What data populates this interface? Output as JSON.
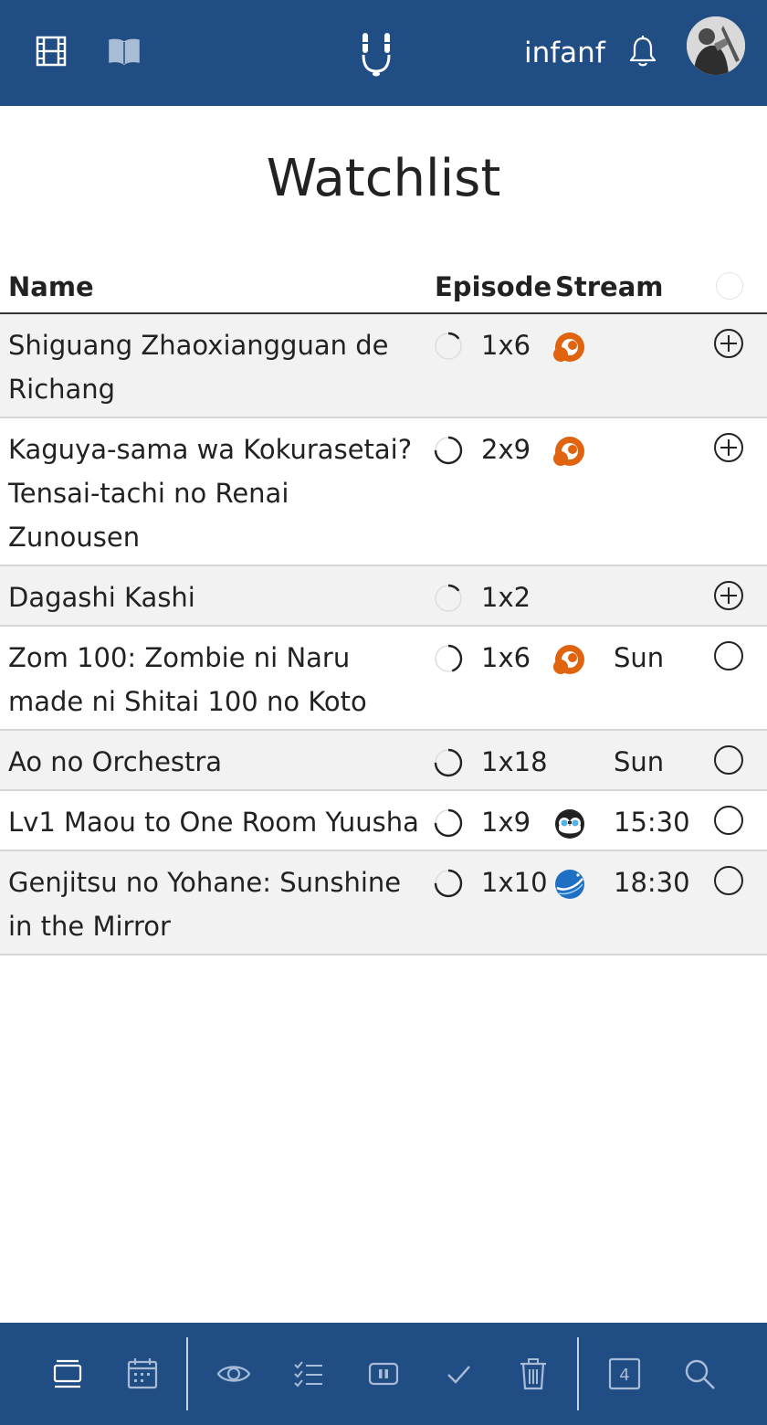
{
  "header": {
    "username": "infanf",
    "icons": [
      "film-icon",
      "book-icon",
      "logo-icon",
      "bell-icon",
      "avatar"
    ]
  },
  "page": {
    "title": "Watchlist"
  },
  "table": {
    "columns": {
      "name": "Name",
      "episode": "Episode",
      "stream": "Stream"
    },
    "rows": [
      {
        "name": "Shiguang Zhaoxiangguan de Richang",
        "episode": "1x6",
        "stream": "crunchyroll-icon",
        "airs": "",
        "action": "add-icon",
        "progress": 0.15
      },
      {
        "name": "Kaguya-sama wa Kokurasetai? Tensai-tachi no Renai Zunousen",
        "episode": "2x9",
        "stream": "crunchyroll-icon",
        "airs": "",
        "action": "add-icon",
        "progress": 0.75
      },
      {
        "name": "Dagashi Kashi",
        "episode": "1x2",
        "stream": "",
        "airs": "",
        "action": "add-icon",
        "progress": 0.15
      },
      {
        "name": "Zom 100: Zombie ni Naru made ni Shitai 100 no Koto",
        "episode": "1x6",
        "stream": "crunchyroll-icon",
        "airs": "Sun",
        "action": "circle-icon",
        "progress": 0.45
      },
      {
        "name": "Ao no Orchestra",
        "episode": "1x18",
        "stream": "",
        "airs": "Sun",
        "action": "circle-icon",
        "progress": 0.75
      },
      {
        "name": "Lv1 Maou to One Room Yuusha",
        "episode": "1x9",
        "stream": "hidive-icon",
        "airs": "15:30",
        "action": "circle-icon",
        "progress": 0.75
      },
      {
        "name": "Genjitsu no Yohane: Sunshine in the Mirror",
        "episode": "1x10",
        "stream": "planet-icon",
        "airs": "18:30",
        "action": "circle-icon",
        "progress": 0.75
      }
    ]
  },
  "bottombar": {
    "icons": [
      "watchlist-icon",
      "calendar-icon",
      "watching-icon",
      "plan-to-watch-icon",
      "paused-icon",
      "completed-icon",
      "dropped-icon",
      "season-icon",
      "search-icon"
    ],
    "season_label": "4"
  },
  "colors": {
    "primary": "#214d85",
    "accent": "#e0630f",
    "row_shade": "#f2f2f2"
  }
}
